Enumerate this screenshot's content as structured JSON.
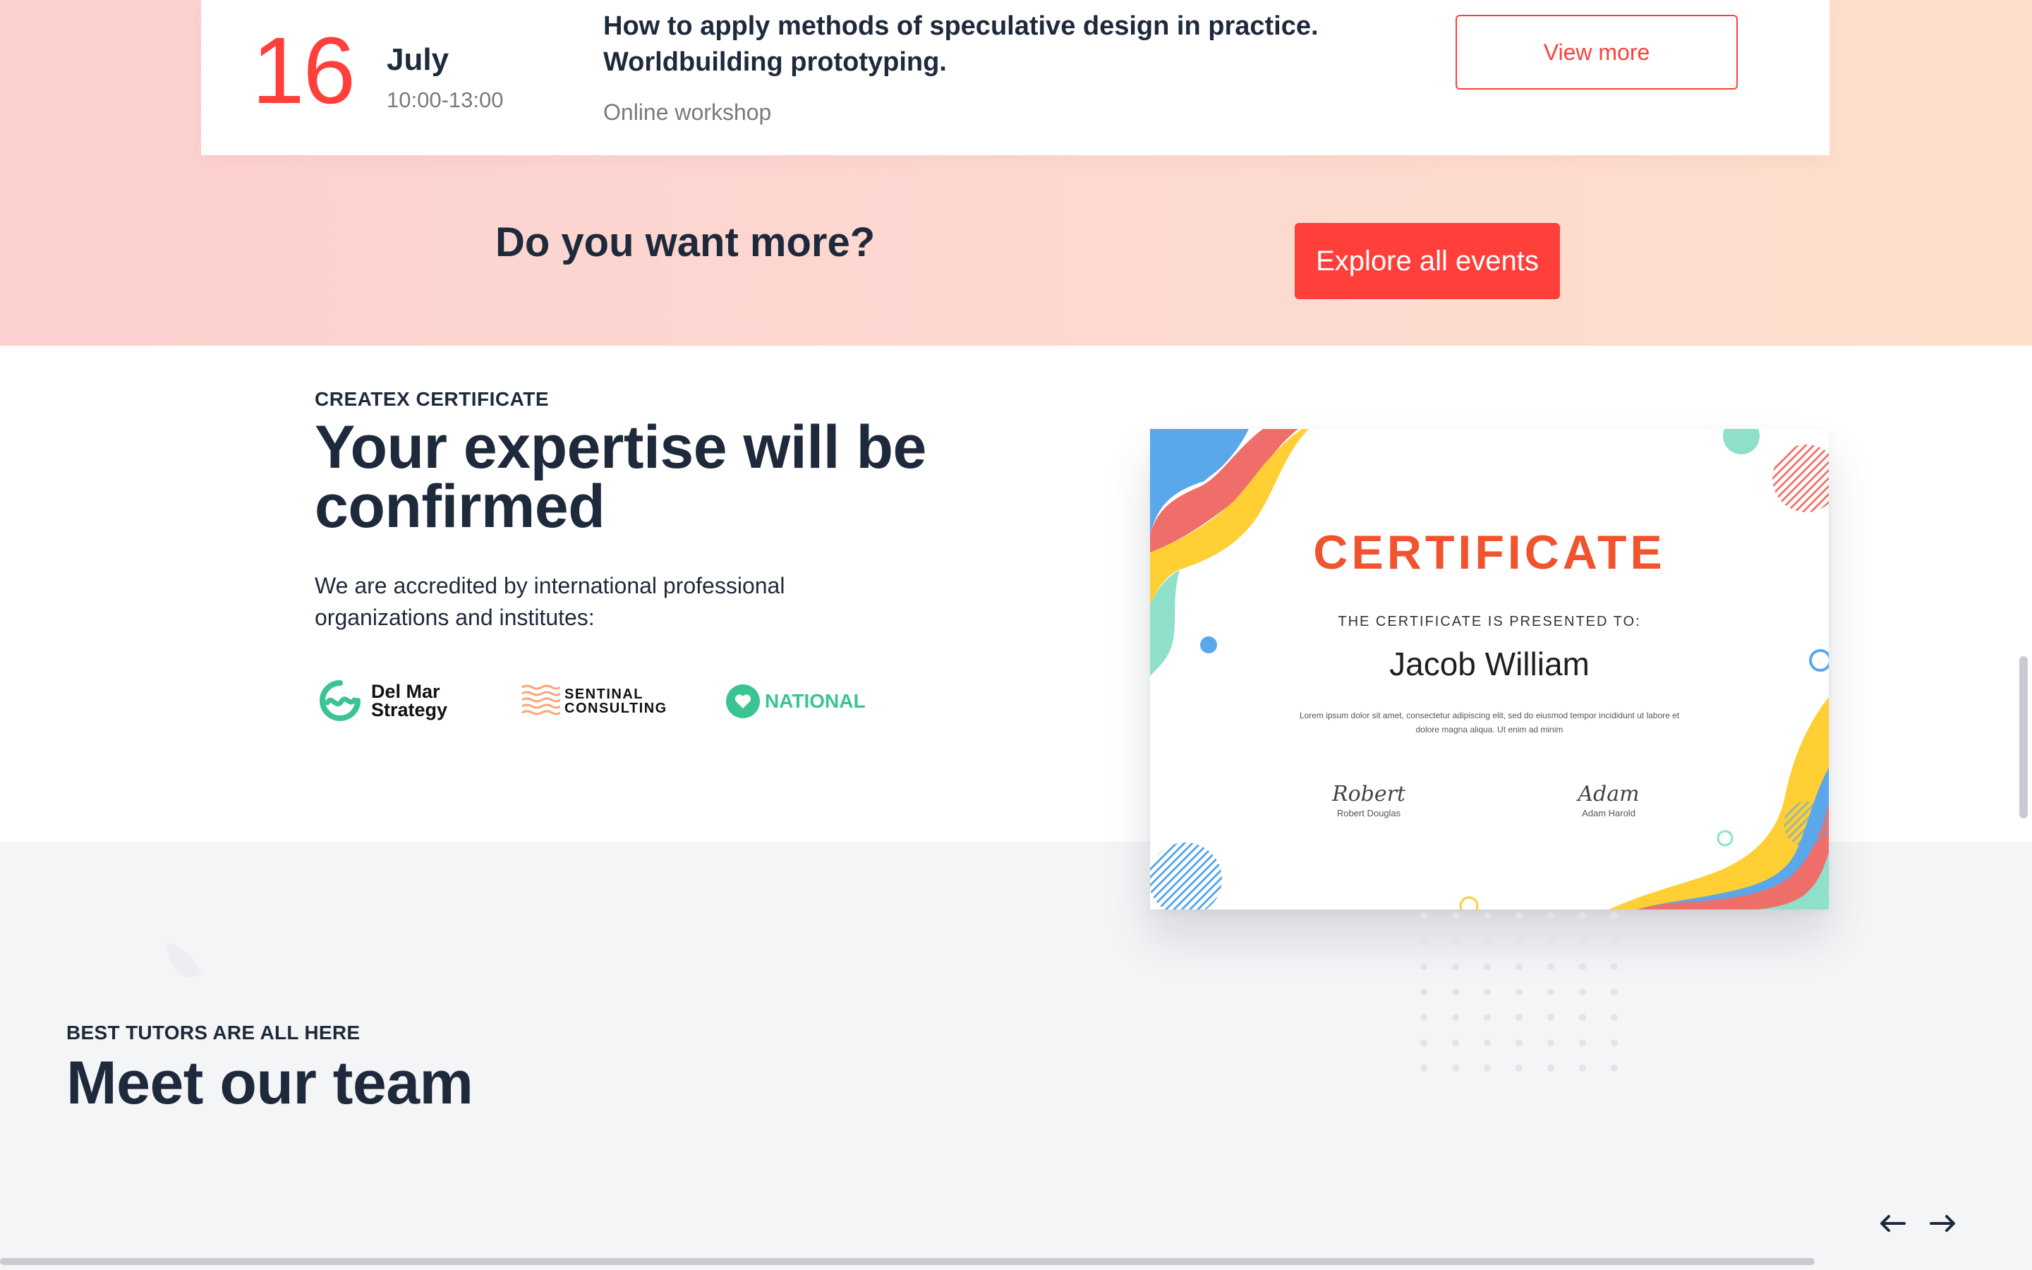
{
  "event": {
    "day": "16",
    "month": "July",
    "time": "10:00-13:00",
    "title": "How to apply methods of speculative design in practice. Worldbuilding prototyping.",
    "type": "Online workshop",
    "view_more_label": "View more"
  },
  "more": {
    "heading": "Do you want more?",
    "explore_label": "Explore all events"
  },
  "certificate_section": {
    "eyebrow": "CREATEX CERTIFICATE",
    "heading": "Your expertise will be confirmed",
    "text": "We are accredited by international professional organizations and institutes:",
    "partners": {
      "delmar_line1": "Del Mar",
      "delmar_line2": "Strategy",
      "sentinal_line1": "SENTINAL",
      "sentinal_line2": "CONSULTING",
      "national": "NATIONAL"
    },
    "certificate": {
      "title": "CERTIFICATE",
      "presented": "THE CERTIFICATE IS PRESENTED TO:",
      "name": "Jacob William",
      "lorem": "Lorem ipsum dolor sit amet, consectetur adipiscing elit, sed do eiusmod tempor incididunt ut labore et dolore magna aliqua. Ut enim ad minim",
      "sig1_script": "Robert",
      "sig1_name": "Robert Douglas",
      "sig2_script": "Adam",
      "sig2_name": "Adam Harold"
    }
  },
  "team": {
    "eyebrow": "BEST TUTORS ARE ALL HERE",
    "heading": "Meet our team",
    "prev_icon": "arrow-left-icon",
    "next_icon": "arrow-right-icon"
  },
  "colors": {
    "accent": "#ff3f3a",
    "text": "#1e2a3b",
    "muted": "#787a80",
    "national_green": "#3ac491"
  }
}
